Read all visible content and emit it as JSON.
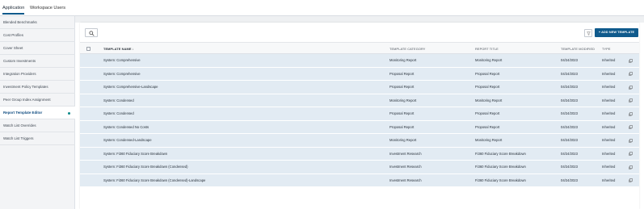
{
  "tabs": [
    {
      "label": "Application",
      "active": true
    },
    {
      "label": "Workspace Users",
      "active": false
    }
  ],
  "sidebar": {
    "items": [
      {
        "label": "Blended Benchmarks"
      },
      {
        "label": "Cost Profiles"
      },
      {
        "label": "Cover Sheet"
      },
      {
        "label": "Custom Investments"
      },
      {
        "label": "Integration Providers"
      },
      {
        "label": "Investment Policy Templates"
      },
      {
        "label": "Peer Group Index Assignment"
      },
      {
        "label": "Report Template Editor",
        "active": true
      },
      {
        "label": "Watch List Overrides"
      },
      {
        "label": "Watch List Triggers"
      }
    ]
  },
  "toolbar": {
    "add_label": "+ ADD NEW TEMPLATE",
    "search_icon": "search-icon",
    "filter_icon": "filter-icon"
  },
  "table": {
    "columns": {
      "name": "TEMPLATE NAME ↓",
      "category": "TEMPLATE CATEGORY",
      "title": "REPORT TITLE",
      "modified": "TEMPLATE MODIFIED",
      "type": "TYPE"
    },
    "rows": [
      {
        "name": "System: Comprehensive",
        "category": "Monitoring Report",
        "title": "Monitoring Report",
        "modified": "04/24/2023",
        "type": "Inherited"
      },
      {
        "name": "System: Comprehensive",
        "category": "Proposal Report",
        "title": "Proposal Report",
        "modified": "04/24/2023",
        "type": "Inherited"
      },
      {
        "name": "System: Comprehensive-Landscape",
        "category": "Proposal Report",
        "title": "Proposal Report",
        "modified": "04/24/2023",
        "type": "Inherited"
      },
      {
        "name": "System: Condensed",
        "category": "Monitoring Report",
        "title": "Monitoring Report",
        "modified": "04/24/2023",
        "type": "Inherited"
      },
      {
        "name": "System: Condensed",
        "category": "Proposal Report",
        "title": "Proposal Report",
        "modified": "04/24/2023",
        "type": "Inherited"
      },
      {
        "name": "System: Condensed No Costs",
        "category": "Proposal Report",
        "title": "Proposal Report",
        "modified": "04/24/2023",
        "type": "Inherited"
      },
      {
        "name": "System: Condensed-Landscape",
        "category": "Monitoring Report",
        "title": "Monitoring Report",
        "modified": "04/24/2023",
        "type": "Inherited"
      },
      {
        "name": "System: Fi360 Fiduciary Score Breakdown",
        "category": "Investment Research",
        "title": "Fi360 Fiduciary Score Breakdown",
        "modified": "04/24/2023",
        "type": "Inherited"
      },
      {
        "name": "System: Fi360 Fiduciary Score Breakdown (Condensed)",
        "category": "Investment Research",
        "title": "Fi360 Fiduciary Score Breakdown",
        "modified": "04/24/2023",
        "type": "Inherited"
      },
      {
        "name": "System: Fi360 Fiduciary Score Breakdown (Condensed)-Landscape",
        "category": "Investment Research",
        "title": "Fi360 Fiduciary Score Breakdown",
        "modified": "04/24/2023",
        "type": "Inherited"
      }
    ]
  },
  "colors": {
    "accent": "#0f5a8c",
    "row_bg": "#e2ebf3",
    "active_dot": "#0e8a8a"
  }
}
